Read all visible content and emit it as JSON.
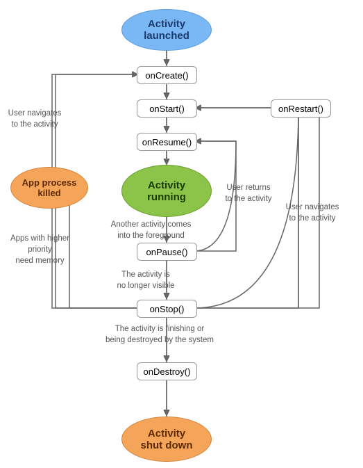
{
  "nodes": {
    "activity_launched": {
      "label": "Activity\nlaunched"
    },
    "on_create": {
      "label": "onCreate()"
    },
    "on_start": {
      "label": "onStart()"
    },
    "on_restart": {
      "label": "onRestart()"
    },
    "on_resume": {
      "label": "onResume()"
    },
    "activity_running": {
      "label": "Activity\nrunning"
    },
    "app_process_killed": {
      "label": "App process\nkilled"
    },
    "on_pause": {
      "label": "onPause()"
    },
    "on_stop": {
      "label": "onStop()"
    },
    "on_destroy": {
      "label": "onDestroy()"
    },
    "activity_shutdown": {
      "label": "Activity\nshut down"
    }
  },
  "labels": {
    "user_navigates_to_activity": "User navigates\nto the activity",
    "another_activity_foreground": "Another activity comes\ninto the foreground",
    "user_returns_to_activity": "User returns\nto the activity",
    "activity_no_longer_visible": "The activity is\nno longer visible",
    "finishing_or_destroyed": "The activity is finishing or\nbeing destroyed by the system",
    "user_navigates_to_activity2": "User navigates\nto the activity",
    "apps_higher_priority": "Apps with higher priority\nneed memory"
  }
}
